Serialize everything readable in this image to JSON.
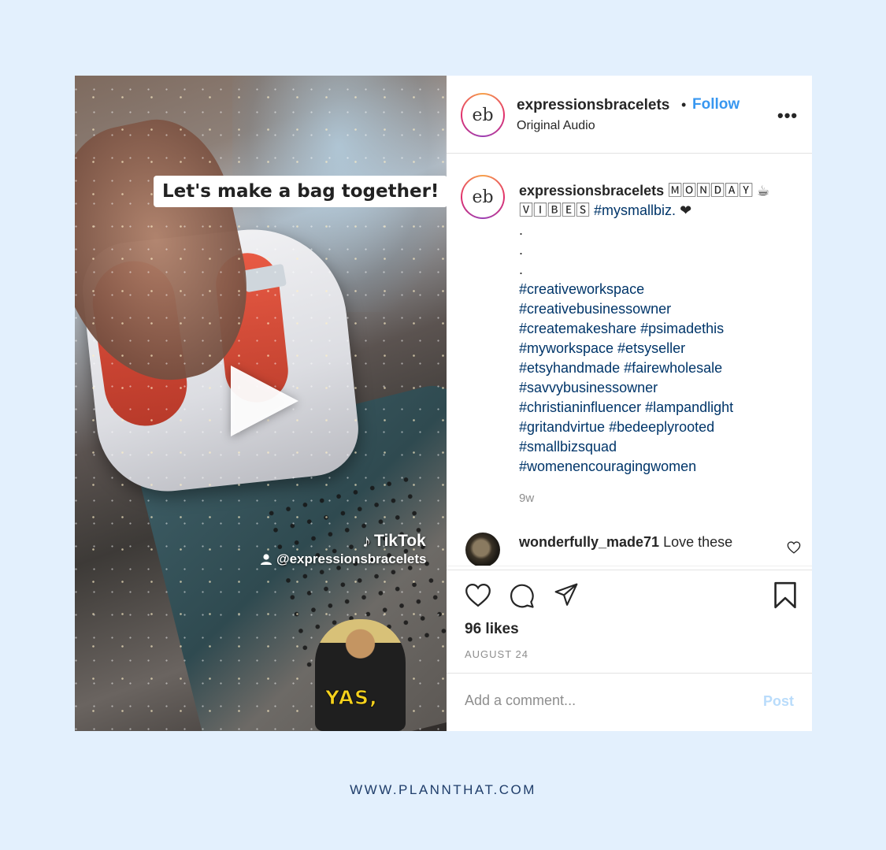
{
  "media": {
    "overlay_text": "Let's make a bag together!",
    "tiktok_label": "TikTok",
    "tiktok_handle": "@expressionsbracelets",
    "sticker_text": "YAS,"
  },
  "header": {
    "username": "expressionsbracelets",
    "separator": "•",
    "follow_label": "Follow",
    "audio": "Original Audio",
    "more": "•••",
    "avatar_letters": "eb"
  },
  "caption": {
    "username": "expressionsbracelets",
    "line1_text": "🄼🄾🄽🄳🄰🅈 ☕",
    "line2_text": "🅅🄸🄱🄴🅂",
    "line2_tag": "#mysmallbiz.",
    "line2_end": "❤",
    "dots": [
      ".",
      ".",
      "."
    ],
    "tags": [
      "#creativeworkspace",
      "#creativebusinessowner",
      "#createmakeshare #psimadethis",
      "#myworkspace #etsyseller",
      "#etsyhandmade #fairewholesale",
      "#savvybusinessowner",
      "#christianinfluencer #lampandlight",
      "#gritandvirtue #bedeeplyrooted",
      "#smallbizsquad",
      "#womenencouragingwomen"
    ],
    "time": "9w"
  },
  "comment": {
    "username": "wonderfully_made71",
    "text": "Love these"
  },
  "engagement": {
    "likes": "96 likes",
    "date": "AUGUST 24"
  },
  "add_comment": {
    "placeholder": "Add a comment...",
    "post_label": "Post"
  },
  "footer": {
    "url": "WWW.PLANNTHAT.COM"
  },
  "colors": {
    "background": "#e3f0fd",
    "follow": "#3897f0",
    "hashtag": "#003569",
    "post_disabled": "#b9dcfb",
    "footer": "#1f3d6a"
  }
}
